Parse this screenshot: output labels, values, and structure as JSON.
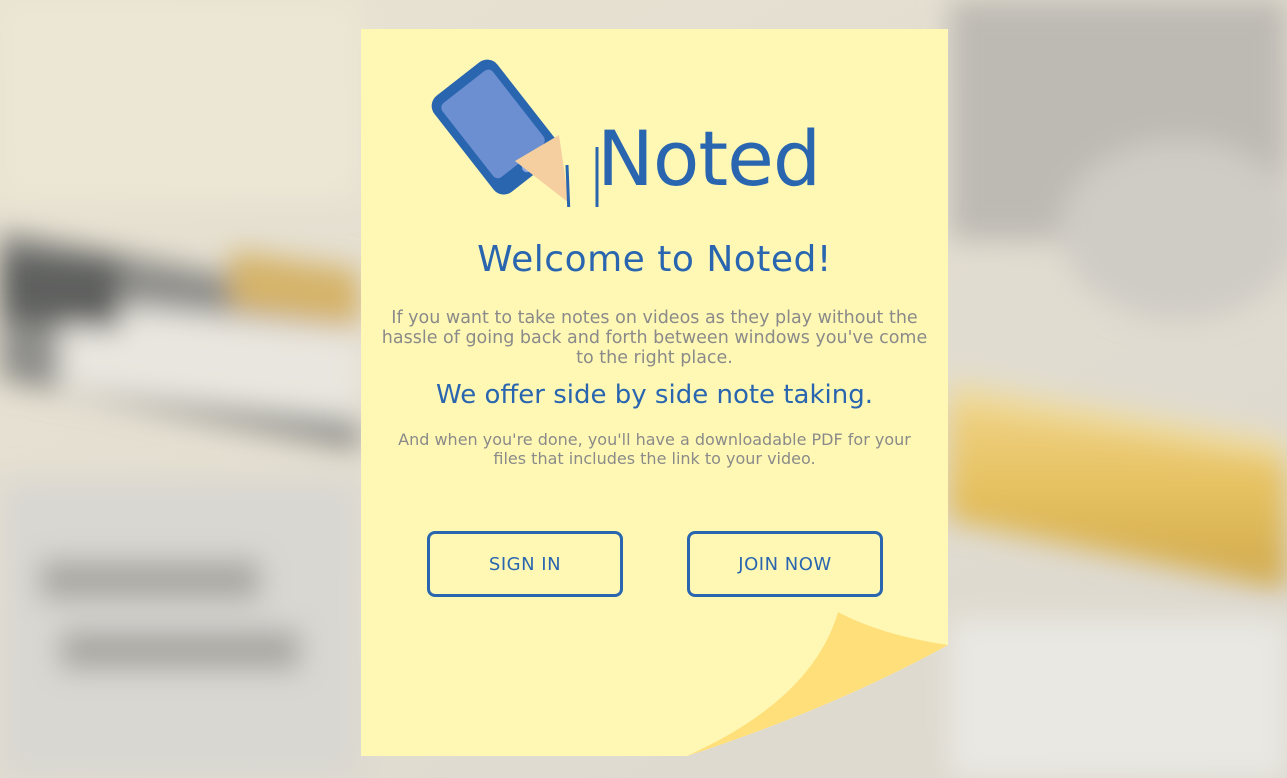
{
  "app": {
    "brand_name": "Noted"
  },
  "hero": {
    "welcome_title": "Welcome to Noted!",
    "intro_text": "If you want to take notes on videos as they play without the hassle of going back and forth between windows you've come to the right place.",
    "offer_heading": "We offer side by side note taking.",
    "pdf_text": "And when you're done, you'll have a downloadable PDF for your files that includes the link to your video."
  },
  "actions": {
    "sign_in_label": "SIGN IN",
    "join_now_label": "JOIN NOW"
  },
  "colors": {
    "accent_blue": "#2a66b0",
    "note_yellow": "#fff8b4",
    "curl_yellow": "#ffdf7a",
    "body_gray": "#8a8a8a",
    "pencil_tip": "#f6cfa0"
  },
  "icons": {
    "logo_icon": "phone-pencil-icon"
  }
}
